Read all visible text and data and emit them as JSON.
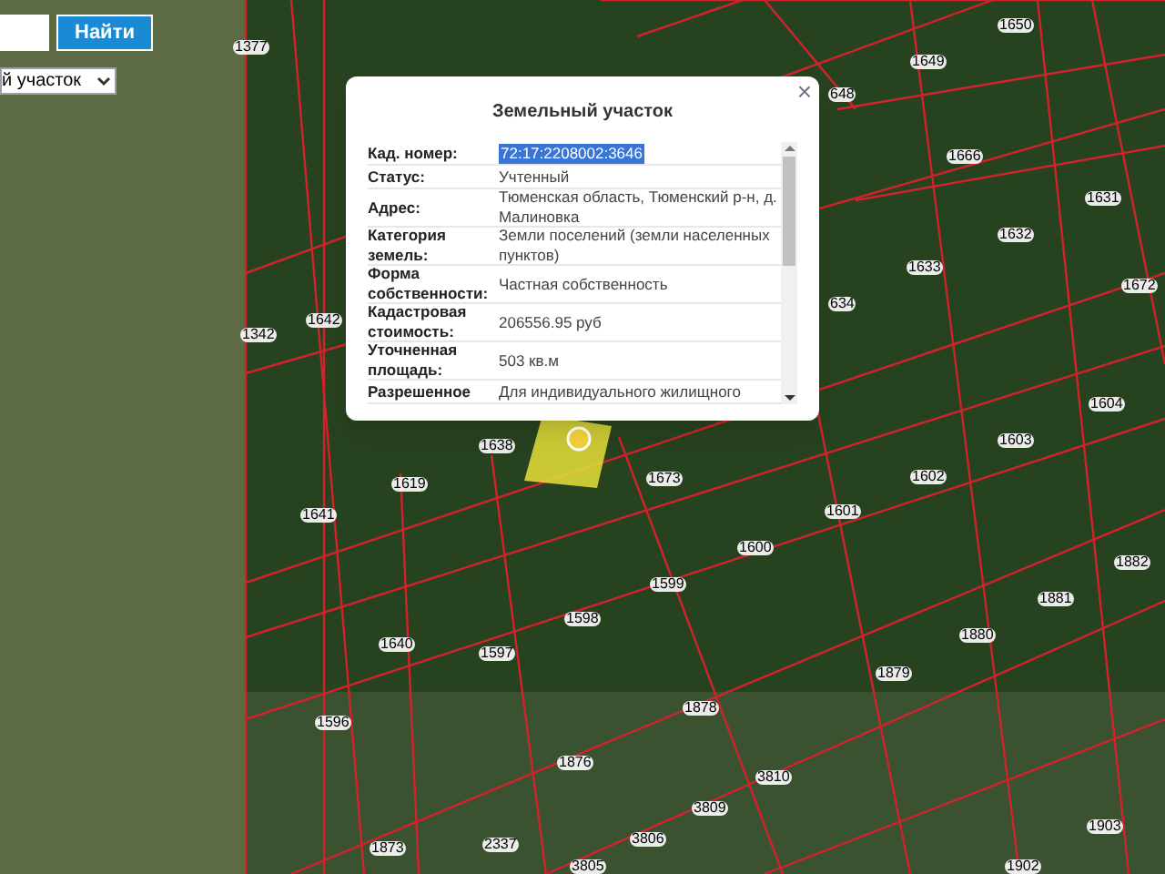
{
  "search": {
    "button": "Найти",
    "select_value": "й участок"
  },
  "popup": {
    "title": "Земельный участок",
    "close": "×",
    "rows": [
      {
        "label": "Кад. номер:",
        "value": "72:17:2208002:3646",
        "selected": true
      },
      {
        "label": "Статус:",
        "value": "Учтенный",
        "selected": false
      },
      {
        "label": "Адрес:",
        "value": "Тюменская область, Тюменский р-н, д. Малиновка",
        "selected": false
      },
      {
        "label": "Категория земель:",
        "value": "Земли поселений (земли населенных пунктов)",
        "selected": false
      },
      {
        "label": "Форма собственности:",
        "value": "Частная собственность",
        "selected": false
      },
      {
        "label": "Кадастровая стоимость:",
        "value": "206556.95 руб",
        "selected": false
      },
      {
        "label": "Уточненная площадь:",
        "value": "503 кв.м",
        "selected": false
      },
      {
        "label": "Разрешенное",
        "value": "Для индивидуального жилищного",
        "selected": false
      }
    ]
  },
  "map": {
    "parcel_labels": [
      "1377",
      "1650",
      "1649",
      "648",
      "1666",
      "1631",
      "1632",
      "1633",
      "634",
      "1672",
      "1342",
      "1642",
      "1604",
      "1603",
      "1602",
      "1601",
      "1600",
      "1599",
      "1598",
      "1597",
      "1596",
      "1640",
      "1641",
      "1619",
      "1638",
      "1673",
      "1882",
      "1881",
      "1880",
      "1879",
      "1878",
      "1876",
      "3810",
      "3809",
      "3806",
      "3805",
      "1873",
      "2337",
      "1902",
      "1903"
    ]
  }
}
